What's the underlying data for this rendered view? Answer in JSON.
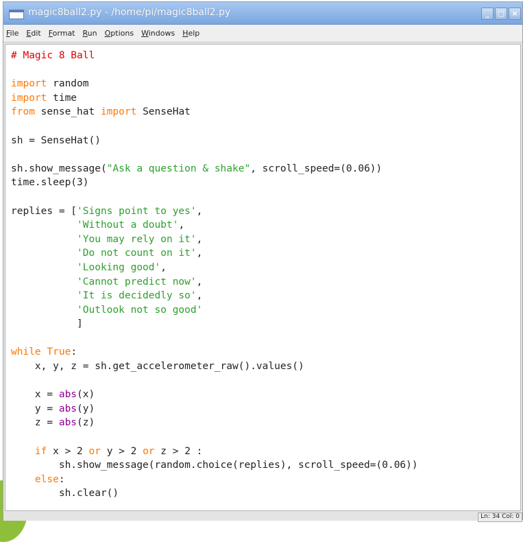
{
  "window": {
    "title": "magic8ball2.py - /home/pi/magic8ball2.py",
    "controls": [
      "_",
      "□",
      "×"
    ]
  },
  "menu": [
    {
      "label": "File",
      "mnemonic": "F",
      "rest": "ile"
    },
    {
      "label": "Edit",
      "mnemonic": "E",
      "rest": "dit"
    },
    {
      "label": "Format",
      "mnemonic": "F",
      "rest": "ormat"
    },
    {
      "label": "Run",
      "mnemonic": "R",
      "rest": "un"
    },
    {
      "label": "Options",
      "mnemonic": "O",
      "rest": "ptions"
    },
    {
      "label": "Windows",
      "mnemonic": "W",
      "rest": "indows"
    },
    {
      "label": "Help",
      "mnemonic": "H",
      "rest": "elp"
    }
  ],
  "code_lines": [
    [
      [
        "c",
        "# Magic 8 Ball"
      ]
    ],
    [],
    [
      [
        "k",
        "import"
      ],
      [
        "n",
        " random"
      ]
    ],
    [
      [
        "k",
        "import"
      ],
      [
        "n",
        " time"
      ]
    ],
    [
      [
        "k",
        "from"
      ],
      [
        "n",
        " sense_hat "
      ],
      [
        "k",
        "import"
      ],
      [
        "n",
        " SenseHat"
      ]
    ],
    [],
    [
      [
        "n",
        "sh = SenseHat()"
      ]
    ],
    [],
    [
      [
        "n",
        "sh.show_message("
      ],
      [
        "s",
        "\"Ask a question & shake\""
      ],
      [
        "n",
        ", scroll_speed=(0.06))"
      ]
    ],
    [
      [
        "n",
        "time.sleep(3)"
      ]
    ],
    [],
    [
      [
        "n",
        "replies = ["
      ],
      [
        "s",
        "'Signs point to yes'"
      ],
      [
        "n",
        ","
      ]
    ],
    [
      [
        "n",
        "           "
      ],
      [
        "s",
        "'Without a doubt'"
      ],
      [
        "n",
        ","
      ]
    ],
    [
      [
        "n",
        "           "
      ],
      [
        "s",
        "'You may rely on it'"
      ],
      [
        "n",
        ","
      ]
    ],
    [
      [
        "n",
        "           "
      ],
      [
        "s",
        "'Do not count on it'"
      ],
      [
        "n",
        ","
      ]
    ],
    [
      [
        "n",
        "           "
      ],
      [
        "s",
        "'Looking good'"
      ],
      [
        "n",
        ","
      ]
    ],
    [
      [
        "n",
        "           "
      ],
      [
        "s",
        "'Cannot predict now'"
      ],
      [
        "n",
        ","
      ]
    ],
    [
      [
        "n",
        "           "
      ],
      [
        "s",
        "'It is decidedly so'"
      ],
      [
        "n",
        ","
      ]
    ],
    [
      [
        "n",
        "           "
      ],
      [
        "s",
        "'Outlook not so good'"
      ]
    ],
    [
      [
        "n",
        "           ]"
      ]
    ],
    [],
    [
      [
        "k",
        "while"
      ],
      [
        "n",
        " "
      ],
      [
        "k",
        "True"
      ],
      [
        "n",
        ":"
      ]
    ],
    [
      [
        "n",
        "    x, y, z = sh.get_accelerometer_raw().values()"
      ]
    ],
    [],
    [
      [
        "n",
        "    x = "
      ],
      [
        "b",
        "abs"
      ],
      [
        "n",
        "(x)"
      ]
    ],
    [
      [
        "n",
        "    y = "
      ],
      [
        "b",
        "abs"
      ],
      [
        "n",
        "(y)"
      ]
    ],
    [
      [
        "n",
        "    z = "
      ],
      [
        "b",
        "abs"
      ],
      [
        "n",
        "(z)"
      ]
    ],
    [],
    [
      [
        "n",
        "    "
      ],
      [
        "k",
        "if"
      ],
      [
        "n",
        " x > 2 "
      ],
      [
        "k",
        "or"
      ],
      [
        "n",
        " y > 2 "
      ],
      [
        "k",
        "or"
      ],
      [
        "n",
        " z > 2 :"
      ]
    ],
    [
      [
        "n",
        "        sh.show_message(random.choice(replies), scroll_speed=(0.06))"
      ]
    ],
    [
      [
        "n",
        "    "
      ],
      [
        "k",
        "else"
      ],
      [
        "n",
        ":"
      ]
    ],
    [
      [
        "n",
        "        sh.clear()"
      ]
    ]
  ],
  "status": {
    "position": "Ln: 34 Col: 0"
  }
}
